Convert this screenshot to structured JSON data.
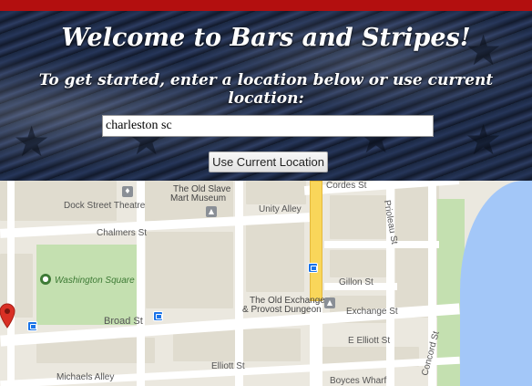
{
  "header": {
    "title": "Welcome to Bars and Stripes!",
    "subtitle": "To get started, enter a location below or use current location:"
  },
  "search": {
    "value": "charleston sc"
  },
  "actions": {
    "current_location_label": "Use Current Location"
  },
  "map": {
    "labels": {
      "cordes_st": "Cordes St",
      "old_slave_mart": "The Old Slave",
      "old_slave_mart_2": "Mart Museum",
      "dock_street": "Dock Street Theatre",
      "unity_alley": "Unity Alley",
      "prioleau_st": "Prioleau St",
      "chalmers_st": "Chalmers St",
      "washington_square": "Washington Square",
      "gillon_st": "Gillon St",
      "old_exchange": "The Old Exchange",
      "old_exchange_2": "& Provost Dungeon",
      "exchange_st": "Exchange St",
      "broad_st": "Broad St",
      "e_elliott_st": "E Elliott St",
      "concord_st": "Concord St",
      "elliott_st": "Elliott St",
      "michaels_alley": "Michaels Alley",
      "boyces_wharf": "Boyces Wharf"
    },
    "colors": {
      "water": "#a3c7f8",
      "park": "#c4e0b0",
      "highway": "#f9d65a",
      "marker": "#d93025"
    }
  }
}
